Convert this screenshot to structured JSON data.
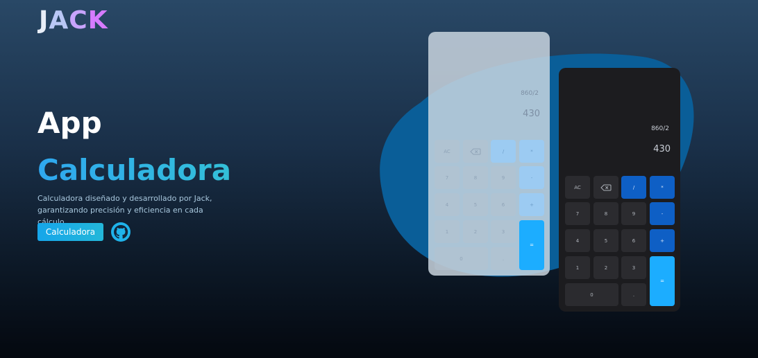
{
  "logo": {
    "text_parts": [
      "J",
      "A",
      "C",
      "K"
    ]
  },
  "hero": {
    "title_line1": "App",
    "title_line2": "Calculadora",
    "description": "Calculadora diseñado y desarrollado por Jack, garantizando precisión y eficiencia en cada cálculo.",
    "cta_label": "Calculadora",
    "github_icon": "github-icon"
  },
  "colors": {
    "accent_blue": "#1cadff",
    "operator_dark": "#0e5fc5",
    "blob": "#0a5e98"
  },
  "calculator": {
    "expression": "860/2",
    "result": "430",
    "keys": {
      "ac": "AC",
      "backspace_icon": "backspace-icon",
      "divide": "/",
      "multiply": "*",
      "seven": "7",
      "eight": "8",
      "nine": "9",
      "minus": "-",
      "four": "4",
      "five": "5",
      "six": "6",
      "plus": "+",
      "one": "1",
      "two": "2",
      "three": "3",
      "equals": "=",
      "zero": "0",
      "dot": "."
    }
  }
}
